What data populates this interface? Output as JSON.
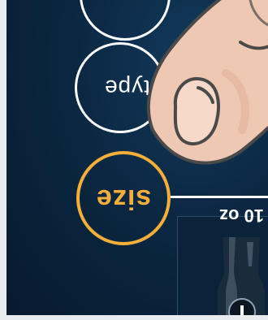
{
  "ui": {
    "options": [
      {
        "label": "",
        "state": "default"
      },
      {
        "label": "type",
        "state": "default"
      },
      {
        "label": "size",
        "state": "selected"
      }
    ],
    "card": {
      "size_label": "10 oz"
    }
  },
  "colors": {
    "accent": "#f5ae3a",
    "background": "#0b2742",
    "outline": "#ffffff",
    "skin": "#efc8b3"
  },
  "icons": {
    "pointer": "finger-pointer-icon",
    "product": "bottle-icon"
  }
}
